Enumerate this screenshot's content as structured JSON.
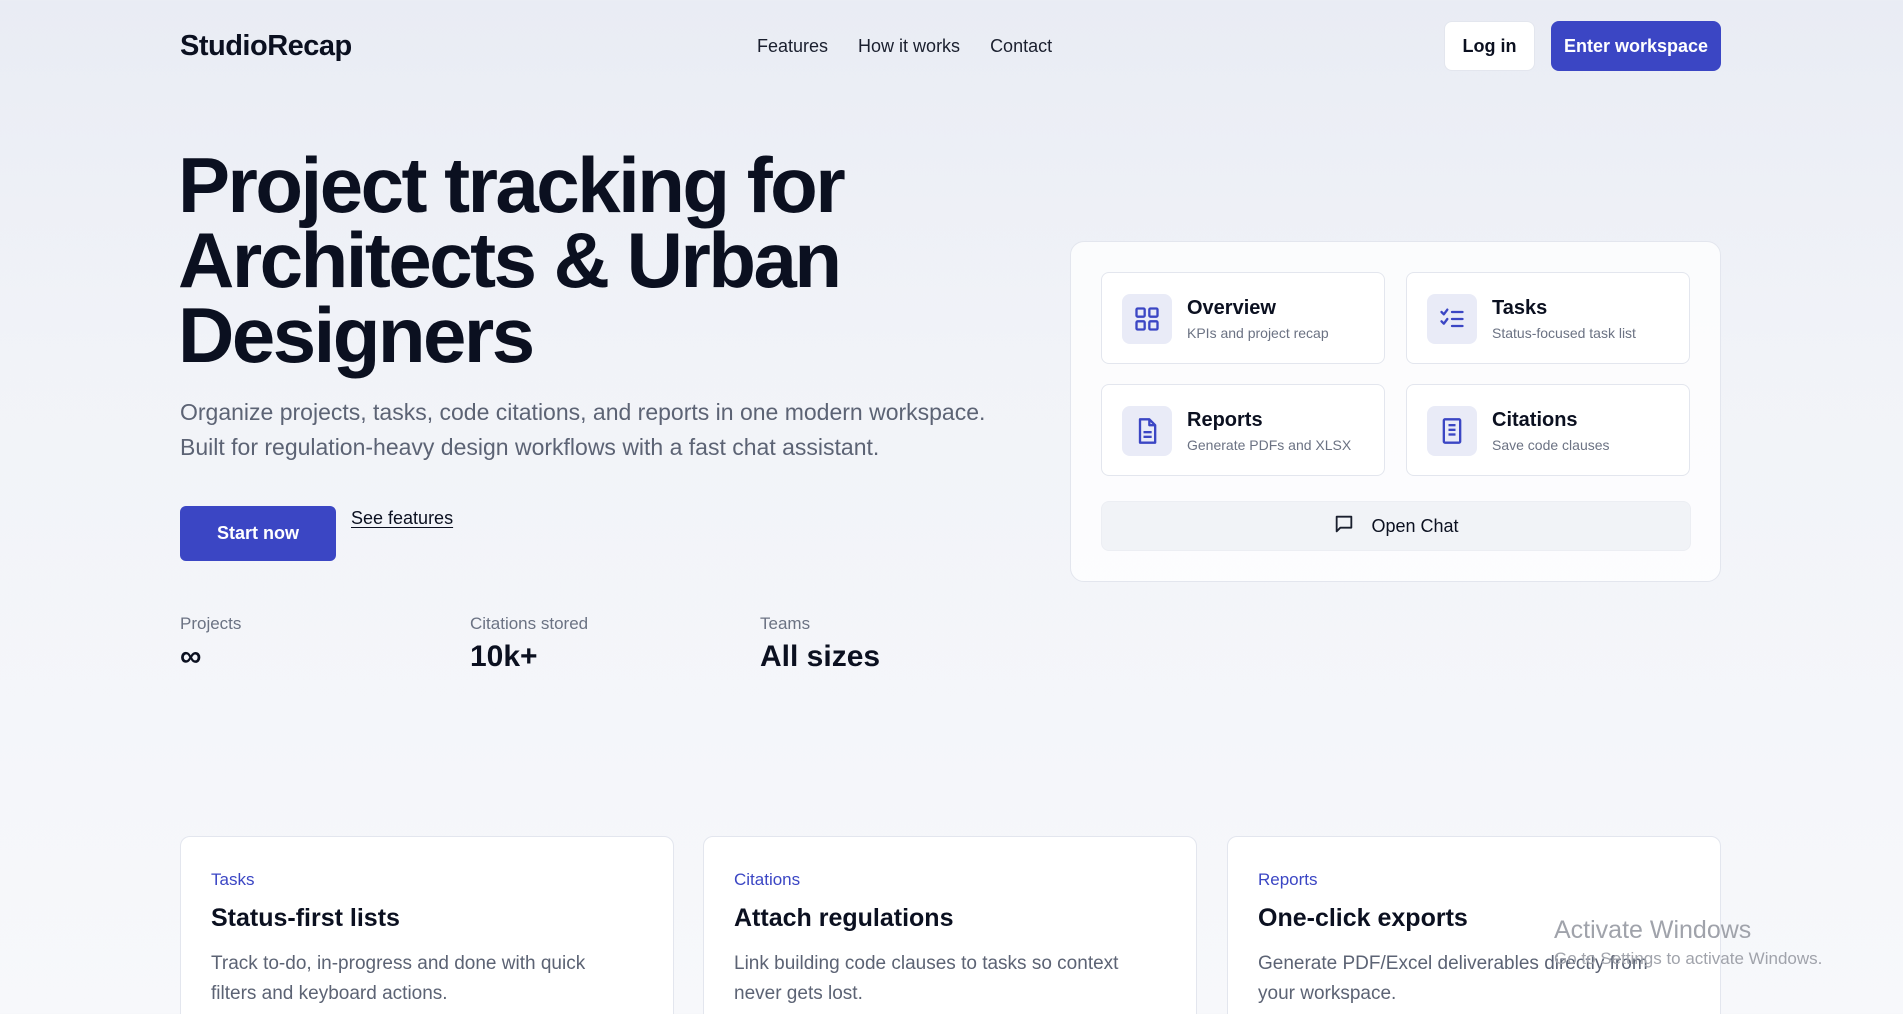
{
  "header": {
    "logo": "StudioRecap",
    "nav": [
      "Features",
      "How it works",
      "Contact"
    ],
    "login_label": "Log in",
    "enter_label": "Enter workspace"
  },
  "hero": {
    "title_lines": [
      "Project tracking for",
      "Architects & Urban",
      "Designers"
    ],
    "subtitle": "Organize projects, tasks, code citations, and reports in one modern workspace. Built for regulation-heavy design workflows with a fast chat assistant.",
    "start_label": "Start now",
    "features_link": "See features",
    "stats": [
      {
        "label": "Projects",
        "value": "∞"
      },
      {
        "label": "Citations stored",
        "value": "10k+"
      },
      {
        "label": "Teams",
        "value": "All sizes"
      }
    ]
  },
  "panel": {
    "tiles": [
      {
        "title": "Overview",
        "desc": "KPIs and project recap",
        "icon": "grid-icon"
      },
      {
        "title": "Tasks",
        "desc": "Status-focused task list",
        "icon": "checklist-icon"
      },
      {
        "title": "Reports",
        "desc": "Generate PDFs and XLSX",
        "icon": "document-icon"
      },
      {
        "title": "Citations",
        "desc": "Save code clauses",
        "icon": "book-icon"
      }
    ],
    "open_chat": "Open Chat",
    "chat_icon": "chat-bubble-icon"
  },
  "cards": [
    {
      "tag": "Tasks",
      "title": "Status-first lists",
      "desc": "Track to-do, in-progress and done with quick filters and keyboard actions."
    },
    {
      "tag": "Citations",
      "title": "Attach regulations",
      "desc": "Link building code clauses to tasks so context never gets lost."
    },
    {
      "tag": "Reports",
      "title": "One-click exports",
      "desc": "Generate PDF/Excel deliverables directly from your workspace."
    }
  ],
  "watermark": {
    "title": "Activate Windows",
    "subtitle": "Go to Settings to activate Windows."
  },
  "colors": {
    "accent": "#3b46c4",
    "text": "#0b1020",
    "muted": "#5c6374"
  }
}
